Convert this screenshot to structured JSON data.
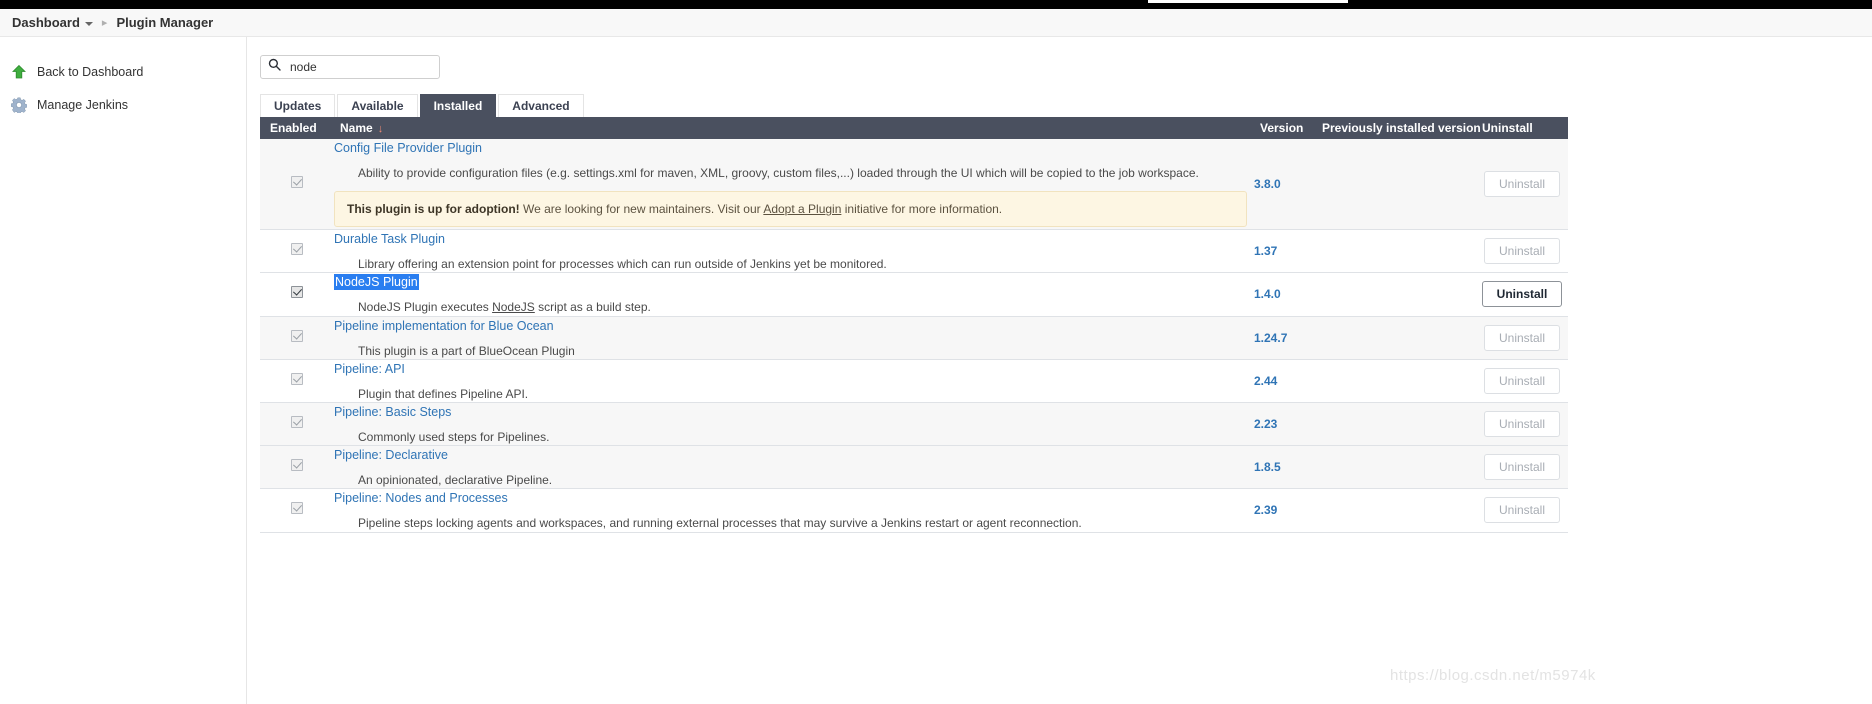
{
  "breadcrumb": {
    "root": "Dashboard",
    "current": "Plugin Manager",
    "separator": "▸"
  },
  "sidebar": {
    "items": [
      {
        "label": "Back to Dashboard",
        "icon": "up-arrow-icon"
      },
      {
        "label": "Manage Jenkins",
        "icon": "gear-icon"
      }
    ]
  },
  "search": {
    "value": "node",
    "placeholder": "",
    "icon": "search-icon"
  },
  "tabs": [
    {
      "label": "Updates",
      "active": false
    },
    {
      "label": "Available",
      "active": false
    },
    {
      "label": "Installed",
      "active": true
    },
    {
      "label": "Advanced",
      "active": false
    }
  ],
  "table": {
    "headers": {
      "enabled": "Enabled",
      "name": "Name",
      "sort_arrow": "↓",
      "version": "Version",
      "previously_installed": "Previously installed version",
      "uninstall": "Uninstall"
    },
    "accent_sort_color": "#ef8a75",
    "header_bg": "#4a505f",
    "rows": [
      {
        "enabled": true,
        "name": "Config File Provider Plugin",
        "selected": false,
        "description": "Ability to provide configuration files (e.g. settings.xml for maven, XML, groovy, custom files,...) loaded through the UI which will be copied to the job workspace.",
        "notice": {
          "strong": "This plugin is up for adoption!",
          "text_before": " We are looking for new maintainers. Visit our ",
          "link": "Adopt a Plugin",
          "text_after": " initiative for more information."
        },
        "version": "3.8.0",
        "previously_installed_version": "",
        "uninstall_label": "Uninstall",
        "uninstall_enabled": false
      },
      {
        "enabled": true,
        "name": "Durable Task Plugin",
        "selected": false,
        "description": "Library offering an extension point for processes which can run outside of Jenkins yet be monitored.",
        "version": "1.37",
        "previously_installed_version": "",
        "uninstall_label": "Uninstall",
        "uninstall_enabled": false
      },
      {
        "enabled": true,
        "name": "NodeJS Plugin",
        "selected": true,
        "description_parts": {
          "before": "NodeJS Plugin executes ",
          "link": "NodeJS",
          "after": " script as a build step."
        },
        "version": "1.4.0",
        "previously_installed_version": "",
        "uninstall_label": "Uninstall",
        "uninstall_enabled": true
      },
      {
        "enabled": true,
        "name": "Pipeline implementation for Blue Ocean",
        "selected": false,
        "description": "This plugin is a part of BlueOcean Plugin",
        "version": "1.24.7",
        "previously_installed_version": "",
        "uninstall_label": "Uninstall",
        "uninstall_enabled": false
      },
      {
        "enabled": true,
        "name": "Pipeline: API",
        "selected": false,
        "description": "Plugin that defines Pipeline API.",
        "version": "2.44",
        "previously_installed_version": "",
        "uninstall_label": "Uninstall",
        "uninstall_enabled": false
      },
      {
        "enabled": true,
        "name": "Pipeline: Basic Steps",
        "selected": false,
        "description": "Commonly used steps for Pipelines.",
        "version": "2.23",
        "previously_installed_version": "",
        "uninstall_label": "Uninstall",
        "uninstall_enabled": false
      },
      {
        "enabled": true,
        "name": "Pipeline: Declarative",
        "selected": false,
        "description": "An opinionated, declarative Pipeline.",
        "version": "1.8.5",
        "previously_installed_version": "",
        "uninstall_label": "Uninstall",
        "uninstall_enabled": false
      },
      {
        "enabled": true,
        "name": "Pipeline: Nodes and Processes",
        "selected": false,
        "description": "Pipeline steps locking agents and workspaces, and running external processes that may survive a Jenkins restart or agent reconnection.",
        "version": "2.39",
        "previously_installed_version": "",
        "uninstall_label": "Uninstall",
        "uninstall_enabled": false
      }
    ]
  },
  "watermark": "https://blog.csdn.net/m5974k"
}
